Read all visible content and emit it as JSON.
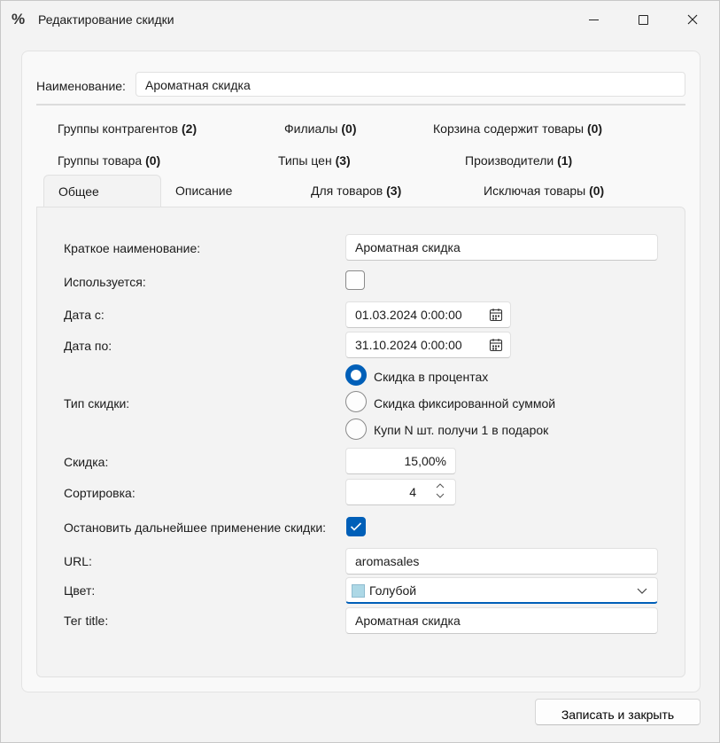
{
  "window": {
    "icon_glyph": "%",
    "title": "Редактирование скидки"
  },
  "header": {
    "name_label": "Наименование:",
    "name_value": "Ароматная скидка"
  },
  "link_tabs": [
    {
      "label": "Группы контрагентов",
      "count": "(2)"
    },
    {
      "label": "Филиалы",
      "count": "(0)"
    },
    {
      "label": "Корзина содержит товары",
      "count": "(0)"
    },
    {
      "label": "Группы товара",
      "count": "(0)"
    },
    {
      "label": "Типы цен",
      "count": "(3)"
    },
    {
      "label": "Производители",
      "count": "(1)"
    }
  ],
  "tabs": [
    {
      "label": "Общее",
      "count": ""
    },
    {
      "label": "Описание",
      "count": ""
    },
    {
      "label": "Для товаров",
      "count": "(3)"
    },
    {
      "label": "Исключая товары",
      "count": "(0)"
    }
  ],
  "form": {
    "short_name_label": "Краткое наименование:",
    "short_name_value": "Ароматная скидка",
    "used_label": "Используется:",
    "used_checked": false,
    "date_from_label": "Дата с:",
    "date_from_value": "01.03.2024 0:00:00",
    "date_to_label": "Дата по:",
    "date_to_value": "31.10.2024 0:00:00",
    "discount_type_label": "Тип скидки:",
    "discount_types": [
      {
        "label": "Скидка в процентах",
        "selected": true
      },
      {
        "label": "Скидка фиксированной суммой",
        "selected": false
      },
      {
        "label": "Купи N шт. получи 1 в подарок",
        "selected": false
      }
    ],
    "discount_label": "Скидка:",
    "discount_value": "15,00%",
    "sort_label": "Сортировка:",
    "sort_value": "4",
    "stop_label": "Остановить дальнейшее применение скидки:",
    "stop_checked": true,
    "url_label": "URL:",
    "url_value": "aromasales",
    "color_label": "Цвет:",
    "color_value": "Голубой",
    "color_swatch": "#add8e6",
    "title_label": "Тег title:",
    "title_value": "Ароматная скидка"
  },
  "footer": {
    "save_close_label": "Записать и закрыть"
  },
  "colors": {
    "accent": "#005fb8"
  }
}
